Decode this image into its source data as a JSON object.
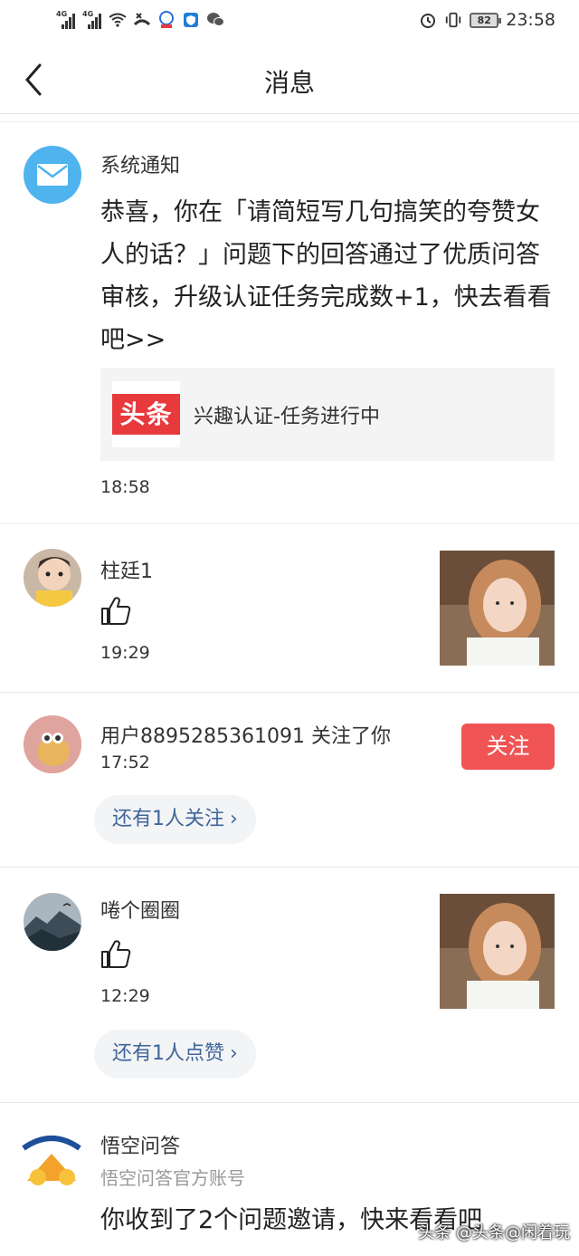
{
  "status_bar": {
    "network_1": "4G",
    "network_2": "4G",
    "battery": "82",
    "time": "23:58",
    "icons": [
      "signal-icon",
      "wifi-icon",
      "missed-call-icon",
      "notification-icon",
      "shield-icon",
      "wechat-icon",
      "alarm-icon",
      "vibrate-icon",
      "battery-icon"
    ]
  },
  "nav": {
    "title": "消息",
    "back_icon": "chevron-left-icon"
  },
  "messages": [
    {
      "sender": "系统通知",
      "text": "恭喜，你在「请简短写几句搞笑的夸赞女人的话？」问题下的回答通过了优质问答审核，升级认证任务完成数+1，快去看看吧>>",
      "card_logo": "头条",
      "card_text": "兴趣认证-任务进行中",
      "time": "18:58"
    },
    {
      "sender": "柱廷1",
      "action_icon": "thumbs-up-icon",
      "time": "19:29"
    },
    {
      "sender": "用户8895285361091 关注了你",
      "time": "17:52",
      "button": "关注",
      "more": "还有1人关注"
    },
    {
      "sender": "啳个圈圈",
      "action_icon": "thumbs-up-icon",
      "time": "12:29",
      "more": "还有1人点赞"
    },
    {
      "sender": "悟空问答",
      "subtitle": "悟空问答官方账号",
      "text": "你收到了2个问题邀请，快来看看吧"
    }
  ],
  "watermark": "头条 @头条@闲着玩",
  "colors": {
    "accent_red": "#f05454",
    "link_blue": "#406599",
    "mail_blue": "#4fb3ee"
  }
}
